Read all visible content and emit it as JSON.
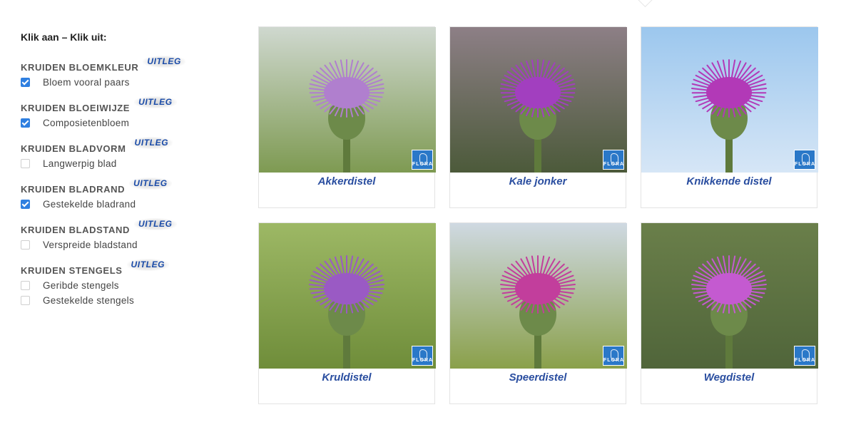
{
  "filters": {
    "intro": "Klik aan – Klik uit:",
    "uitleg_label": "UITLEG",
    "groups": [
      {
        "title": "KRUIDEN BLOEMKLEUR",
        "options": [
          {
            "label": "Bloem vooral paars",
            "checked": true
          }
        ]
      },
      {
        "title": "KRUIDEN BLOEIWIJZE",
        "options": [
          {
            "label": "Composietenbloem",
            "checked": true
          }
        ]
      },
      {
        "title": "KRUIDEN BLADVORM",
        "options": [
          {
            "label": "Langwerpig blad",
            "checked": false
          }
        ]
      },
      {
        "title": "KRUIDEN BLADRAND",
        "options": [
          {
            "label": "Gestekelde bladrand",
            "checked": true
          }
        ]
      },
      {
        "title": "KRUIDEN BLADSTAND",
        "options": [
          {
            "label": "Verspreide bladstand",
            "checked": false
          }
        ]
      },
      {
        "title": "KRUIDEN STENGELS",
        "options": [
          {
            "label": "Geribde stengels",
            "checked": false
          },
          {
            "label": "Gestekelde stengels",
            "checked": false
          }
        ]
      }
    ]
  },
  "results": {
    "badge_text": "FLORA",
    "cards": [
      {
        "name": "Akkerdistel",
        "sky": "#cfd8cf",
        "ground": "#7e9a52",
        "flower": "#b07fce"
      },
      {
        "name": "Kale jonker",
        "sky": "#8d7f86",
        "ground": "#4c5a3a",
        "flower": "#a23fbf"
      },
      {
        "name": "Knikkende distel",
        "sky": "#9cc7ee",
        "ground": "#d6e6f6",
        "flower": "#b239b7"
      },
      {
        "name": "Kruldistel",
        "sky": "#9db865",
        "ground": "#6f8d3a",
        "flower": "#9a5ac4"
      },
      {
        "name": "Speerdistel",
        "sky": "#cfd9e2",
        "ground": "#8aa04a",
        "flower": "#c23e9c"
      },
      {
        "name": "Wegdistel",
        "sky": "#6a7f4a",
        "ground": "#50653a",
        "flower": "#c45ad0"
      }
    ]
  }
}
